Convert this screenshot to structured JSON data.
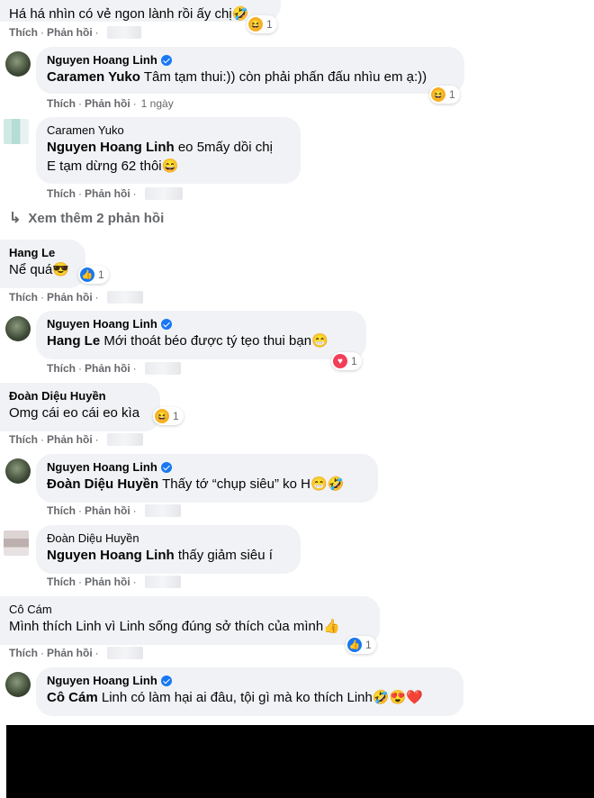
{
  "labels": {
    "like": "Thích",
    "reply": "Phản hồi",
    "sep": "·"
  },
  "comments": [
    {
      "text": "Há há nhìn có vẻ ngon lành rồi ấy chị🤣",
      "reaction_count": "1"
    },
    {
      "author": "Nguyen Hoang Linh",
      "mention": "Caramen Yuko",
      "text": " Tâm tạm thui:)) còn phải phấn đấu nhìu em ạ:))",
      "time": "1 ngày",
      "reaction_count": "1"
    },
    {
      "author": "Caramen Yuko",
      "mention": "Nguyen Hoang Linh",
      "text": " eo 5mấy dồi chị",
      "text2": "E tạm dừng 62 thôi😄"
    },
    {
      "author": "Hang Le",
      "text": "Nể quá😎",
      "reaction_count": "1"
    },
    {
      "author": "Nguyen Hoang Linh",
      "mention": "Hang Le",
      "text": " Mới thoát béo được tý tẹo thui bạn😁",
      "reaction_count": "1"
    },
    {
      "author": "Đoàn Diệu Huyền",
      "text": "Omg cái eo cái eo kìa",
      "reaction_count": "1"
    },
    {
      "author": "Nguyen Hoang Linh",
      "mention": "Đoàn Diệu Huyền",
      "text": " Thấy tớ “chụp siêu” ko H😁🤣"
    },
    {
      "author": "Đoàn Diệu Huyền",
      "mention": "Nguyen Hoang Linh",
      "text": " thấy giảm siêu í"
    },
    {
      "author": "Cô Cám",
      "text": "Mình thích Linh vì Linh sống đúng sở thích của mình👍",
      "reaction_count": "1"
    },
    {
      "author": "Nguyen Hoang Linh",
      "mention": "Cô Cám",
      "text": " Linh có làm hại ai đâu, tội gì mà ko thích Linh🤣😍❤️"
    }
  ],
  "view_more": "Xem thêm 2 phản hồi",
  "colors": {
    "bubble": "#f0f2f5",
    "meta": "#65676b",
    "verified": "#1877f2",
    "redaction": "#000000"
  }
}
